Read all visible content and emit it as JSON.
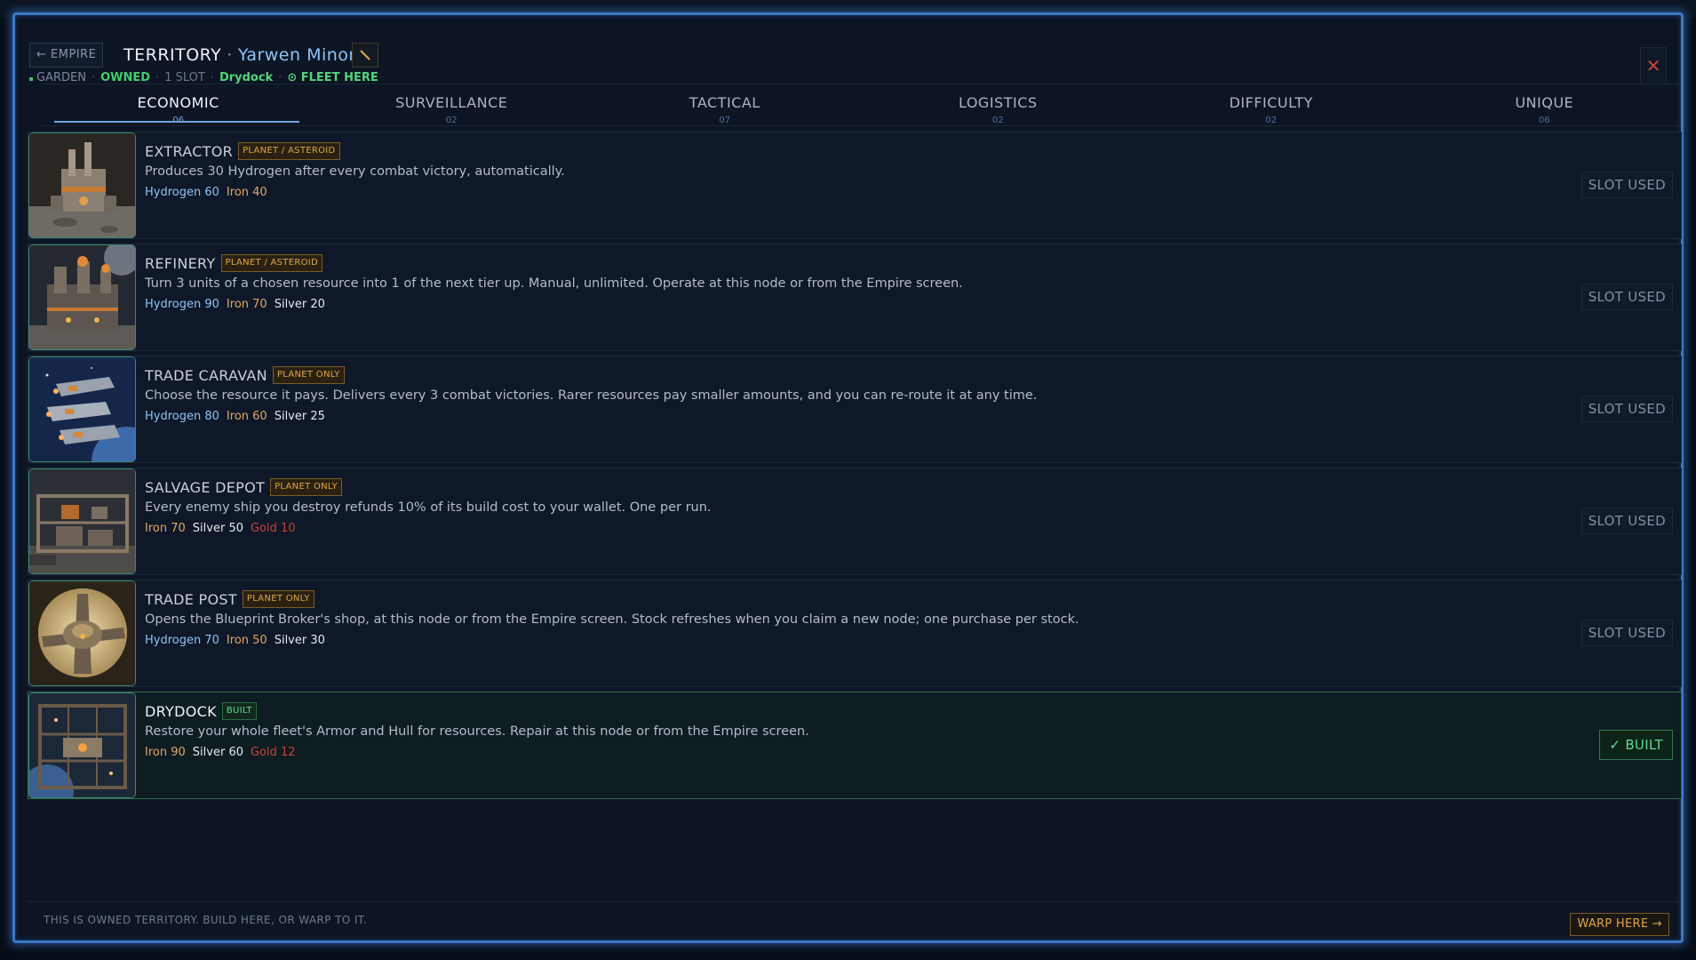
{
  "header": {
    "back_label": "← EMPIRE",
    "title": "TERRITORY",
    "title_sep": "·",
    "node_name": "Yarwen Minor",
    "edit_icon": "pencil-icon",
    "close_label": "✕"
  },
  "subline": {
    "planet_type": "GARDEN",
    "sep": "·",
    "ownership": "OWNED",
    "slots": "1 SLOT",
    "building": "Drydock",
    "fleet": "⊙ FLEET HERE"
  },
  "tabs": [
    {
      "label": "ECONOMIC",
      "count": "06",
      "active": true
    },
    {
      "label": "SURVEILLANCE",
      "count": "02"
    },
    {
      "label": "TACTICAL",
      "count": "07"
    },
    {
      "label": "LOGISTICS",
      "count": "02"
    },
    {
      "label": "DIFFICULTY",
      "count": "02"
    },
    {
      "label": "UNIQUE",
      "count": "06"
    }
  ],
  "buildings": [
    {
      "name": "EXTRACTOR",
      "tag": "PLANET / ASTEROID",
      "desc": "Produces 30 Hydrogen after every combat victory, automatically.",
      "costs": [
        {
          "res": "Hydrogen",
          "amt": "60"
        },
        {
          "res": "Iron",
          "amt": "40"
        }
      ],
      "status": "SLOT USED"
    },
    {
      "name": "REFINERY",
      "tag": "PLANET / ASTEROID",
      "desc": "Turn 3 units of a chosen resource into 1 of the next tier up. Manual, unlimited. Operate at this node or from the Empire screen.",
      "costs": [
        {
          "res": "Hydrogen",
          "amt": "90"
        },
        {
          "res": "Iron",
          "amt": "70"
        },
        {
          "res": "Silver",
          "amt": "20"
        }
      ],
      "status": "SLOT USED"
    },
    {
      "name": "TRADE CARAVAN",
      "tag": "PLANET ONLY",
      "desc": "Choose the resource it pays. Delivers every 3 combat victories. Rarer resources pay smaller amounts, and you can re-route it at any time.",
      "costs": [
        {
          "res": "Hydrogen",
          "amt": "80"
        },
        {
          "res": "Iron",
          "amt": "60"
        },
        {
          "res": "Silver",
          "amt": "25"
        }
      ],
      "status": "SLOT USED"
    },
    {
      "name": "SALVAGE DEPOT",
      "tag": "PLANET ONLY",
      "desc": "Every enemy ship you destroy refunds 10% of its build cost to your wallet. One per run.",
      "costs": [
        {
          "res": "Iron",
          "amt": "70"
        },
        {
          "res": "Silver",
          "amt": "50"
        },
        {
          "res": "Gold",
          "amt": "10"
        }
      ],
      "status": "SLOT USED"
    },
    {
      "name": "TRADE POST",
      "tag": "PLANET ONLY",
      "desc": "Opens the Blueprint Broker's shop, at this node or from the Empire screen. Stock refreshes when you claim a new node; one purchase per stock.",
      "costs": [
        {
          "res": "Hydrogen",
          "amt": "70"
        },
        {
          "res": "Iron",
          "amt": "50"
        },
        {
          "res": "Silver",
          "amt": "30"
        }
      ],
      "status": "SLOT USED"
    },
    {
      "name": "DRYDOCK",
      "tag": "BUILT",
      "desc": "Restore your whole fleet's Armor and Hull for resources. Repair at this node or from the Empire screen.",
      "costs": [
        {
          "res": "Iron",
          "amt": "90"
        },
        {
          "res": "Silver",
          "amt": "60"
        },
        {
          "res": "Gold",
          "amt": "12"
        }
      ],
      "status": "✓ BUILT",
      "built": true
    }
  ],
  "footer": {
    "note": "THIS IS OWNED TERRITORY. BUILD HERE, OR WARP TO IT.",
    "warp_label": "WARP HERE →"
  },
  "colors": {
    "accent_blue": "#3a79c9",
    "owned_green": "#3fcf6e",
    "tag_amber": "#e0a64a",
    "hydrogen": "#8fc3f5",
    "iron": "#e0a664",
    "silver": "#e6e9ee",
    "gold": "#c9403b"
  }
}
